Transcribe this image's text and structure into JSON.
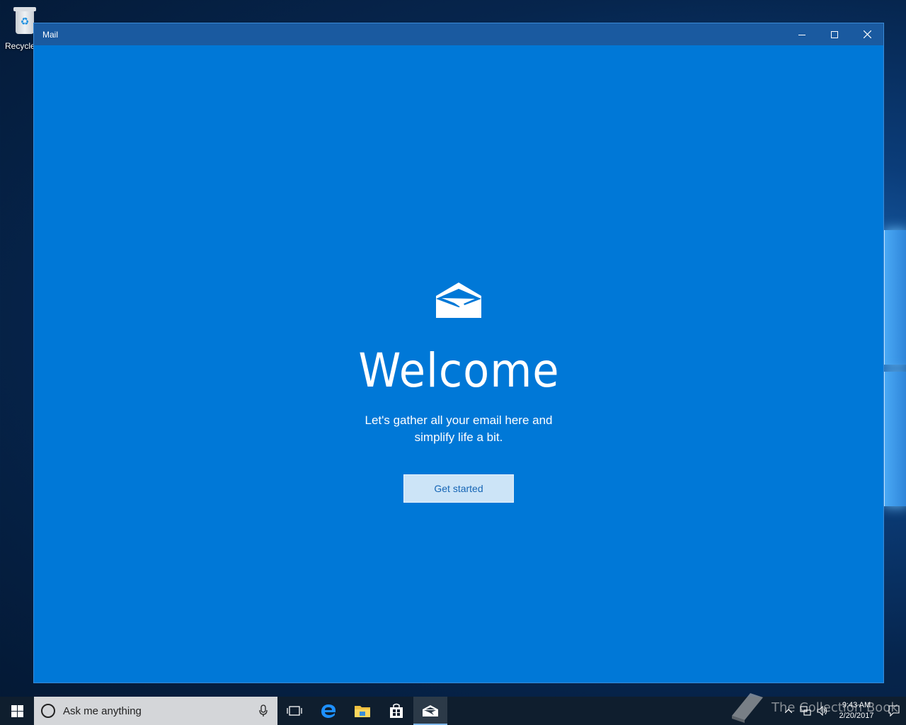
{
  "desktop": {
    "recycle_bin_label": "Recycle"
  },
  "window": {
    "title": "Mail",
    "controls": {
      "minimize": "minimize-icon",
      "maximize": "maximize-icon",
      "close": "close-icon"
    }
  },
  "welcome": {
    "icon": "mail-envelope-icon",
    "heading": "Welcome",
    "subtitle": "Let's gather all your email here and simplify life a bit.",
    "button_label": "Get started"
  },
  "taskbar": {
    "search_placeholder": "Ask me anything",
    "pinned": [
      "task-view-icon",
      "edge-icon",
      "file-explorer-icon",
      "store-icon",
      "mail-icon"
    ],
    "active_app": "mail-icon",
    "clock_time": "9:43 AM",
    "clock_date": "2/20/2017"
  },
  "watermark": {
    "text": "The Collection Book"
  },
  "colors": {
    "accent": "#0078d7",
    "titlebar": "#1a5aa0",
    "button_bg": "#cce4f7",
    "button_text": "#1565b5",
    "taskbar": "#0f1e2e"
  }
}
